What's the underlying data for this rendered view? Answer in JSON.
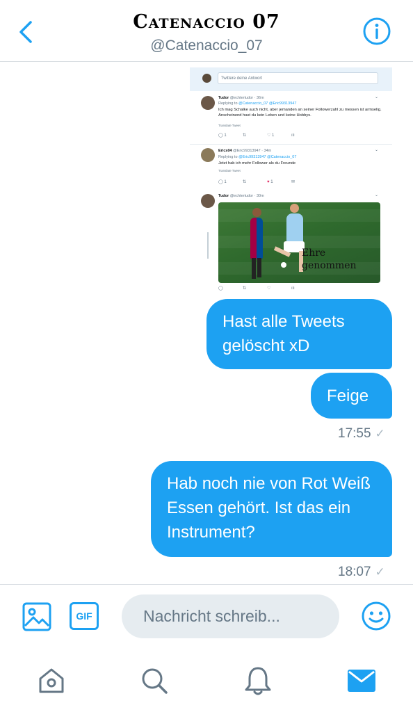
{
  "header": {
    "title": "Catenaccio 07",
    "handle": "@Catenaccio_07"
  },
  "screenshot": {
    "reply_placeholder": "Twittere deine Antwort",
    "tweets": [
      {
        "name": "Tudor",
        "handle_time": "@echtertudor · 36m",
        "replying_to": "Replying to",
        "mentions": "@Catenaccio_07 @Eric99313947",
        "text": "Ich mag Schalke auch nicht, aber jemanden an seiner Followerzahl zu messen ist armselig. Anscheinend hast du kein Leben und keine Hobbys.",
        "translate": "Translate Tweet",
        "actions": [
          "1",
          "",
          "1",
          ""
        ]
      },
      {
        "name": "Erics04",
        "handle_time": "@Eric99313947 · 34m",
        "replying_to": "Replying to",
        "mentions": "@Eric99313947 @Catenaccio_07",
        "text": "Jetzt hab ich mehr Follower als du Freunde",
        "translate": "Translate Tweet",
        "actions": [
          "1",
          "",
          "1",
          ""
        ]
      },
      {
        "name": "Tudor",
        "handle_time": "@echtertudor · 30m",
        "image_caption_line1": "Ehre",
        "image_caption_line2": "genommen"
      }
    ]
  },
  "messages": [
    {
      "text": "Hast alle Tweets gelöscht xD"
    },
    {
      "text": "Feige",
      "time": "17:55"
    },
    {
      "text": "Hab noch nie von Rot Weiß Essen gehört. Ist das ein Instrument?",
      "time": "18:07"
    }
  ],
  "composer": {
    "gif_label": "GIF",
    "placeholder": "Nachricht schreib..."
  },
  "colors": {
    "accent": "#1da1f2",
    "input_bg": "#e6ecf0",
    "muted": "#657786"
  },
  "icons": [
    "back-icon",
    "info-icon",
    "image-icon",
    "gif-icon",
    "emoji-icon",
    "home-icon",
    "search-icon",
    "bell-icon",
    "mail-icon"
  ]
}
